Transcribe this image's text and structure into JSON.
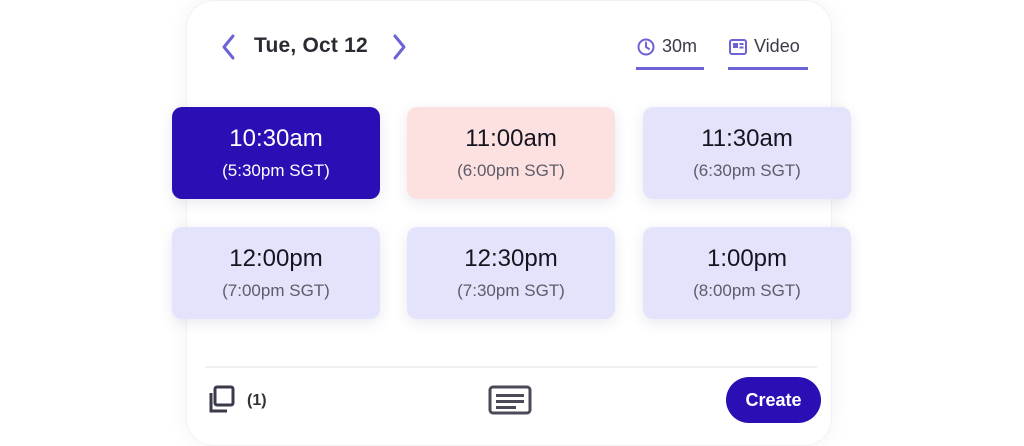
{
  "header": {
    "date": "Tue, Oct 12",
    "prev_icon": "chevron-left-icon",
    "next_icon": "chevron-right-icon",
    "duration": {
      "label": "30m",
      "icon": "clock-icon"
    },
    "meeting_type": {
      "label": "Video",
      "icon": "video-icon"
    },
    "accent_color": "#6b63d6"
  },
  "slots": [
    {
      "time": "10:30am",
      "local": "(5:30pm SGT)",
      "state": "selected"
    },
    {
      "time": "11:00am",
      "local": "(6:00pm SGT)",
      "state": "busy"
    },
    {
      "time": "11:30am",
      "local": "(6:30pm SGT)",
      "state": "available"
    },
    {
      "time": "12:00pm",
      "local": "(7:00pm SGT)",
      "state": "available"
    },
    {
      "time": "12:30pm",
      "local": "(7:30pm SGT)",
      "state": "available"
    },
    {
      "time": "1:00pm",
      "local": "(8:00pm SGT)",
      "state": "available"
    }
  ],
  "colors": {
    "selected": "#2b0fb5",
    "busy": "#fde1e1",
    "available": "#e3e3fb"
  },
  "footer": {
    "copy_icon": "copy-icon",
    "copy_count": "(1)",
    "keyboard_icon": "keyboard-icon",
    "create_label": "Create"
  }
}
